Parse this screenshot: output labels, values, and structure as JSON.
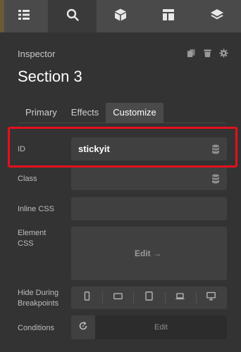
{
  "toolbar": {
    "items": [
      {
        "icon": "list-icon",
        "active": false
      },
      {
        "icon": "search-icon",
        "active": true
      },
      {
        "icon": "cube-icon",
        "active": false
      },
      {
        "icon": "layout-icon",
        "active": false
      },
      {
        "icon": "layers-icon",
        "active": false
      }
    ]
  },
  "inspector": {
    "label": "Inspector",
    "title": "Section 3",
    "header_icons": [
      "copy-icon",
      "trash-icon",
      "gear-icon"
    ]
  },
  "tabs": [
    {
      "label": "Primary",
      "active": false
    },
    {
      "label": "Effects",
      "active": false
    },
    {
      "label": "Customize",
      "active": true
    }
  ],
  "fields": {
    "id": {
      "label": "ID",
      "value": "stickyit"
    },
    "class": {
      "label": "Class",
      "value": ""
    },
    "inline_css": {
      "label": "Inline CSS",
      "value": ""
    },
    "element_css": {
      "label_line1": "Element",
      "label_line2": "CSS",
      "edit": "Edit →"
    },
    "hide_breakpoints": {
      "label_line1": "Hide During",
      "label_line2": "Breakpoints",
      "devices": [
        "phone-icon",
        "tablet-landscape-icon",
        "tablet-icon",
        "laptop-icon",
        "desktop-icon"
      ]
    },
    "conditions": {
      "label": "Conditions",
      "edit": "Edit"
    }
  },
  "colors": {
    "highlight": "#e4101f",
    "background": "#333333",
    "toolbar": "#4a4a4a"
  }
}
